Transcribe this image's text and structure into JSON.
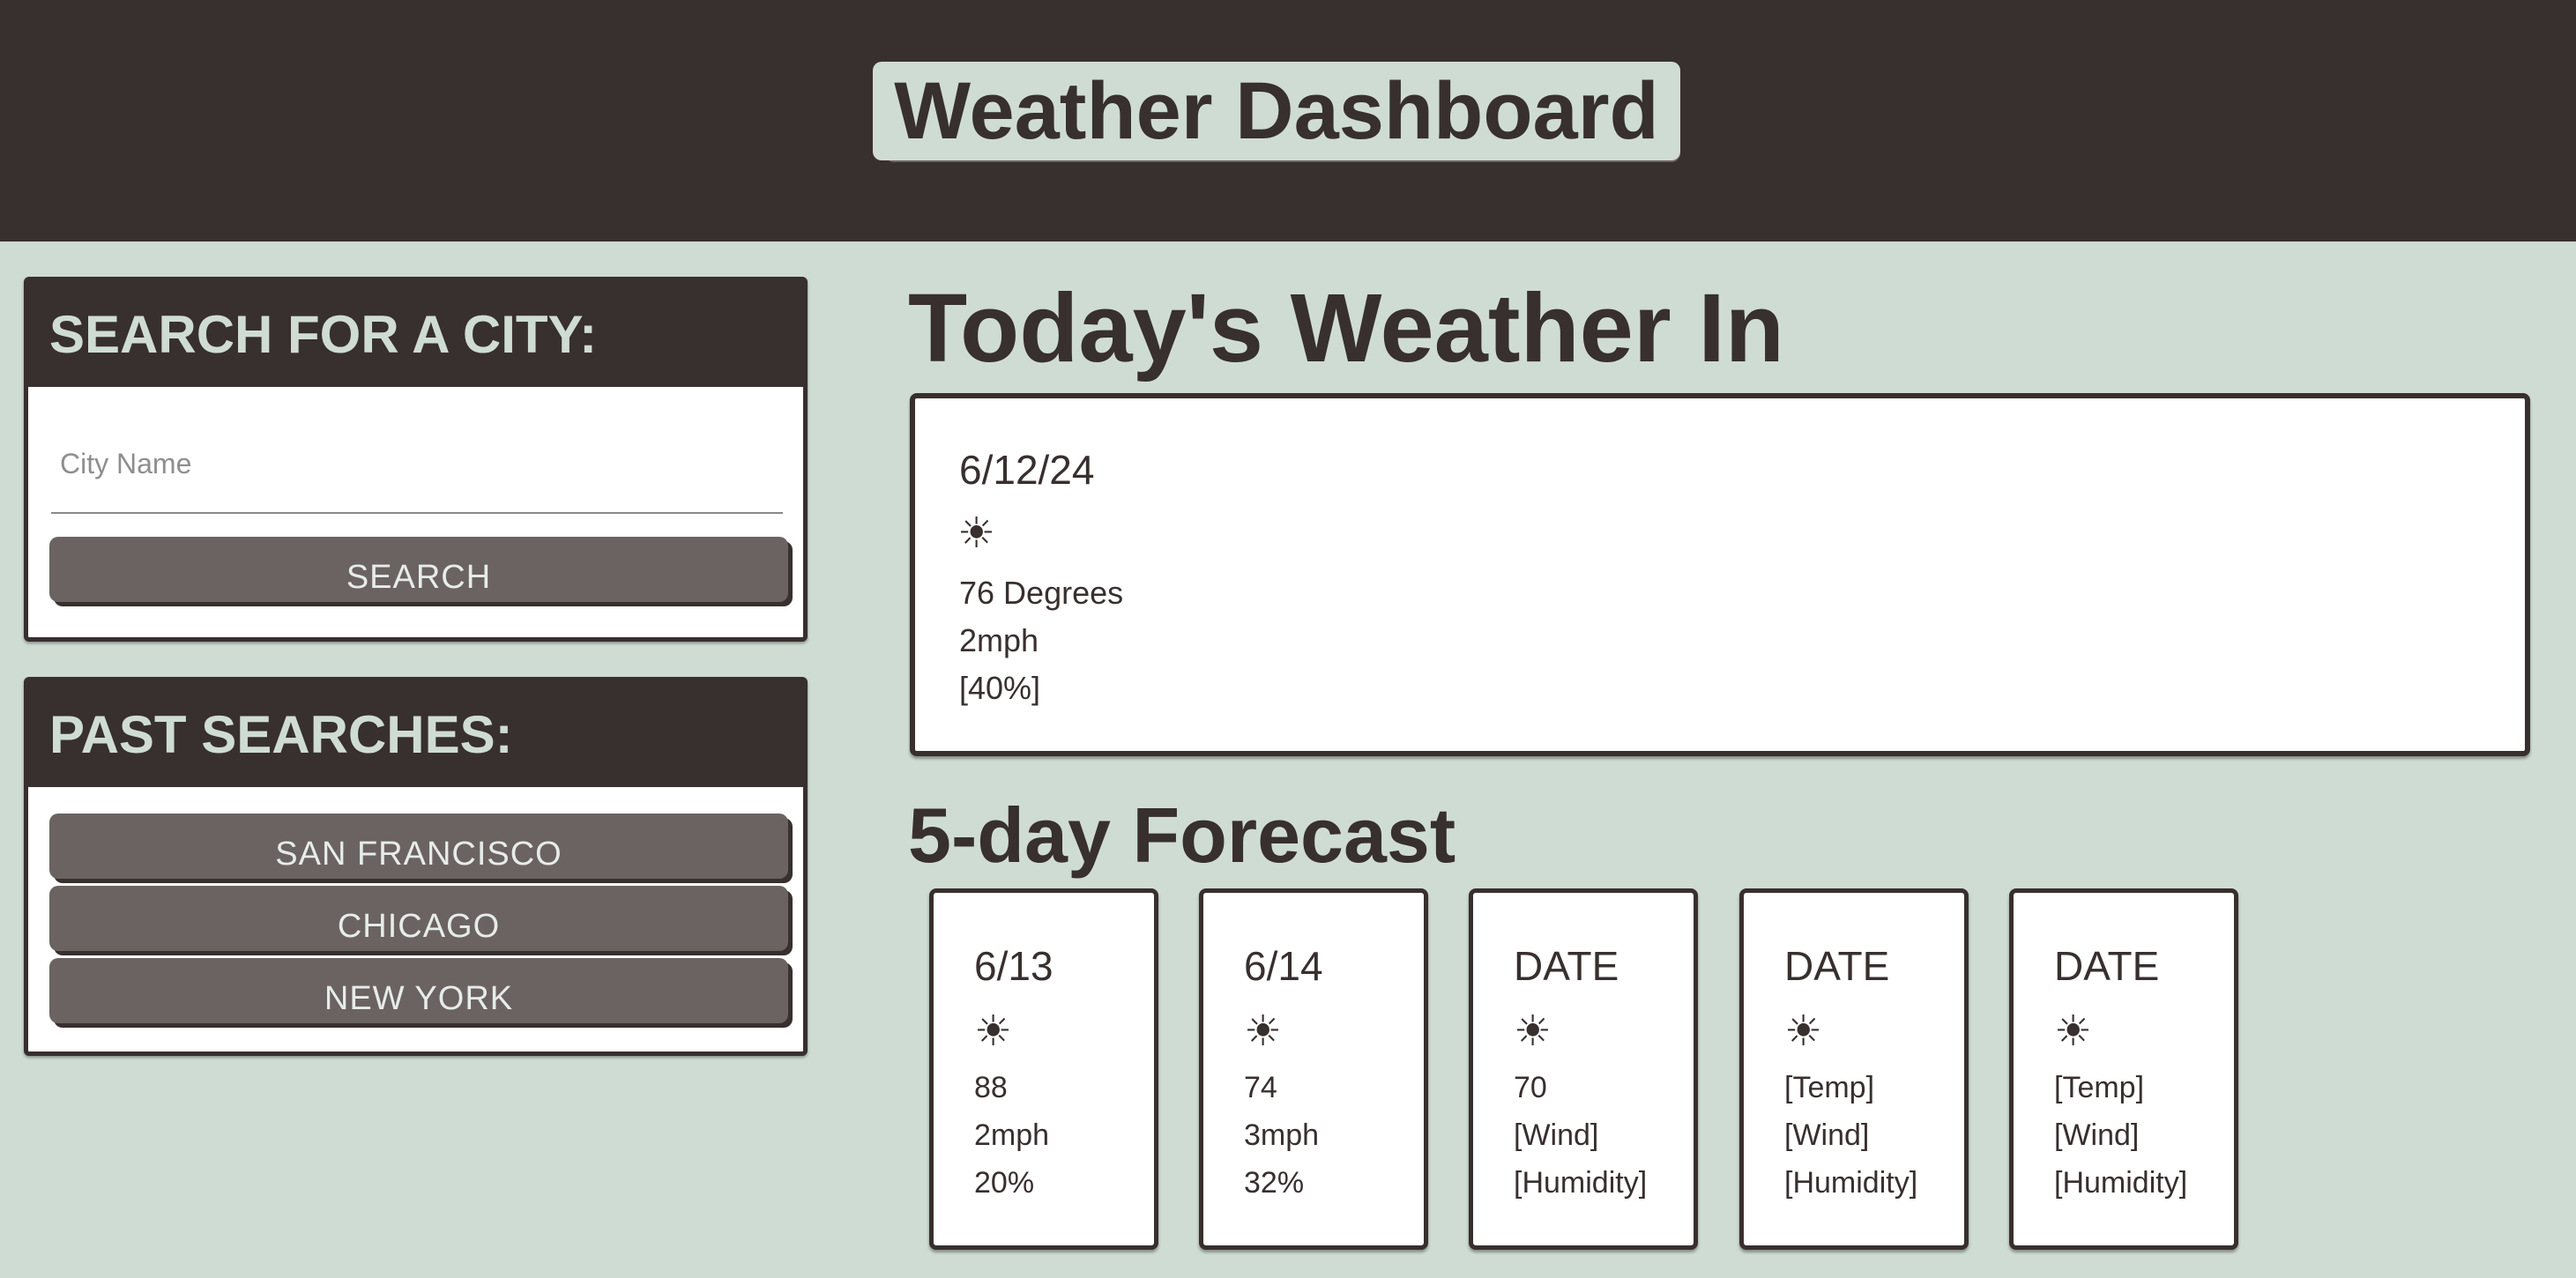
{
  "header": {
    "title": "Weather Dashboard"
  },
  "search": {
    "heading": "SEARCH FOR A CITY:",
    "placeholder": "City Name",
    "value": "",
    "button_label": "SEARCH"
  },
  "past_searches": {
    "heading": "PAST SEARCHES:",
    "items": [
      {
        "label": "SAN FRANCISCO"
      },
      {
        "label": "CHICAGO"
      },
      {
        "label": "NEW YORK"
      }
    ]
  },
  "today": {
    "heading": "Today's Weather In",
    "date": "6/12/24",
    "icon": "sun-icon",
    "icon_glyph": "☀",
    "temp": "76 Degrees",
    "wind": "2mph",
    "humidity": "[40%]"
  },
  "forecast": {
    "heading": "5-day Forecast",
    "days": [
      {
        "date": "6/13",
        "icon": "sun-icon",
        "icon_glyph": "☀",
        "temp": "88",
        "wind": "2mph",
        "humidity": "20%"
      },
      {
        "date": "6/14",
        "icon": "sun-icon",
        "icon_glyph": "☀",
        "temp": "74",
        "wind": "3mph",
        "humidity": "32%"
      },
      {
        "date": "DATE",
        "icon": "sun-icon",
        "icon_glyph": "☀",
        "temp": "70",
        "wind": "[Wind]",
        "humidity": "[Humidity]"
      },
      {
        "date": "DATE",
        "icon": "sun-icon",
        "icon_glyph": "☀",
        "temp": "[Temp]",
        "wind": "[Wind]",
        "humidity": "[Humidity]"
      },
      {
        "date": "DATE",
        "icon": "sun-icon",
        "icon_glyph": "☀",
        "temp": "[Temp]",
        "wind": "[Wind]",
        "humidity": "[Humidity]"
      }
    ]
  },
  "colors": {
    "dark": "#382f2f",
    "background": "#cfdcd4",
    "button": "#6b6362",
    "card": "#ffffff"
  }
}
